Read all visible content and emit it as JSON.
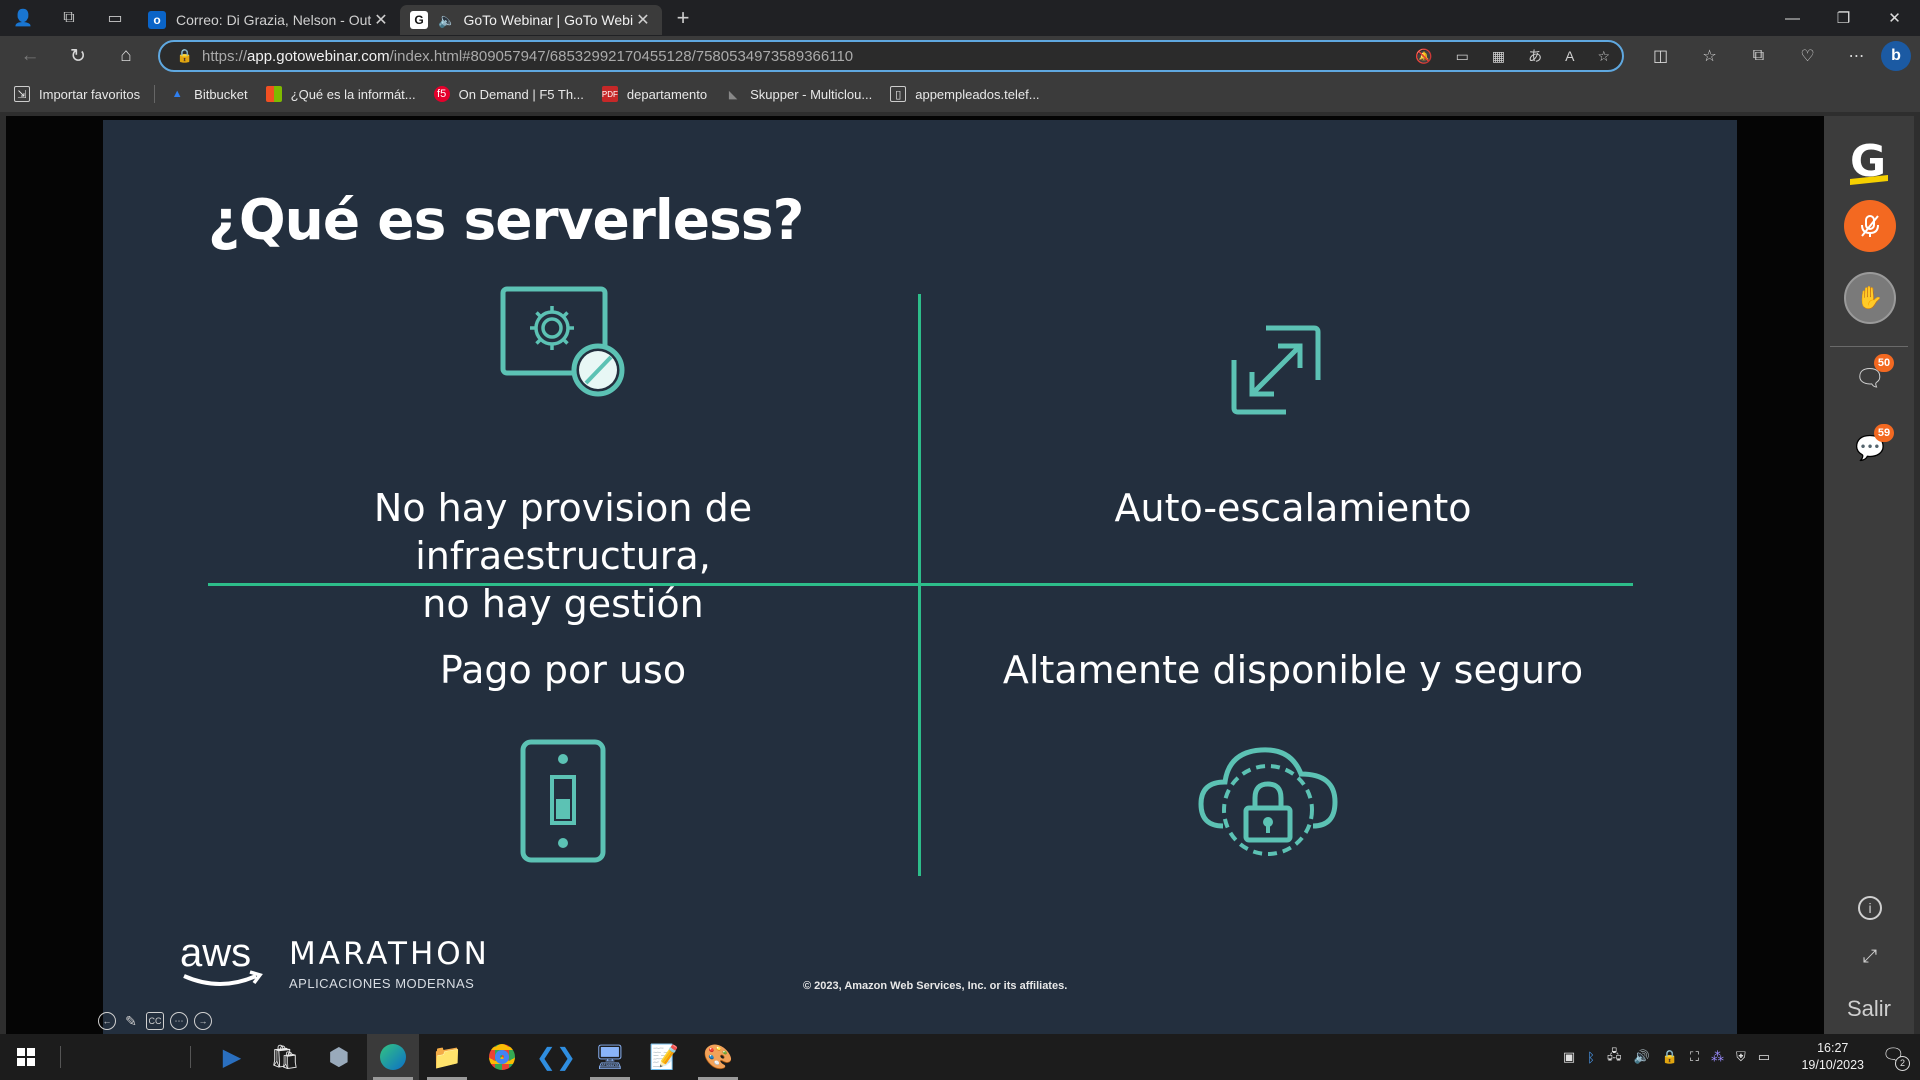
{
  "browser": {
    "tabs": [
      {
        "title": "Correo: Di Grazia, Nelson - Outlo",
        "favicon": "outlook-icon",
        "active": false
      },
      {
        "title": "GoTo Webinar | GoTo Webir",
        "favicon": "goto-icon",
        "active": true
      }
    ],
    "address": {
      "scheme": "https://",
      "host": "app.gotowebinar.com",
      "path": "/index.html#809057947/6853299217045512​8/7580534973589366110"
    },
    "bookmarks": [
      {
        "label": "Importar favoritos",
        "icon": "import-icon"
      },
      {
        "label": "Bitbucket",
        "icon": "bitbucket-icon"
      },
      {
        "label": "¿Qué es la informát...",
        "icon": "microsoft-icon"
      },
      {
        "label": "On Demand | F5 Th...",
        "icon": "f5-icon"
      },
      {
        "label": "departamento",
        "icon": "pdf-icon"
      },
      {
        "label": "Skupper - Multiclou...",
        "icon": "skupper-icon"
      },
      {
        "label": "appempleados.telef...",
        "icon": "page-icon"
      }
    ]
  },
  "slide": {
    "title": "¿Qué es serverless?",
    "quadrants": {
      "top_left": [
        "No hay provision de infraestructura,",
        "no hay gestión"
      ],
      "top_right": "Auto-escalamiento",
      "bottom_left": "Pago por uso",
      "bottom_right": "Altamente disponible y seguro"
    },
    "brand_aws": "aws",
    "brand_event": "MARATHON",
    "brand_sub": "APLICACIONES MODERNAS",
    "copyright": "© 2023, Amazon Web Services, Inc. or its affiliates.",
    "accent_color": "#2dbd8a",
    "icon_color": "#5cc2b4"
  },
  "panel": {
    "logo": "G",
    "questions_count": "50",
    "chat_count": "59",
    "exit_label": "Salir"
  },
  "taskbar": {
    "time": "16:27",
    "date": "19/10/2023",
    "notifications": "2"
  }
}
